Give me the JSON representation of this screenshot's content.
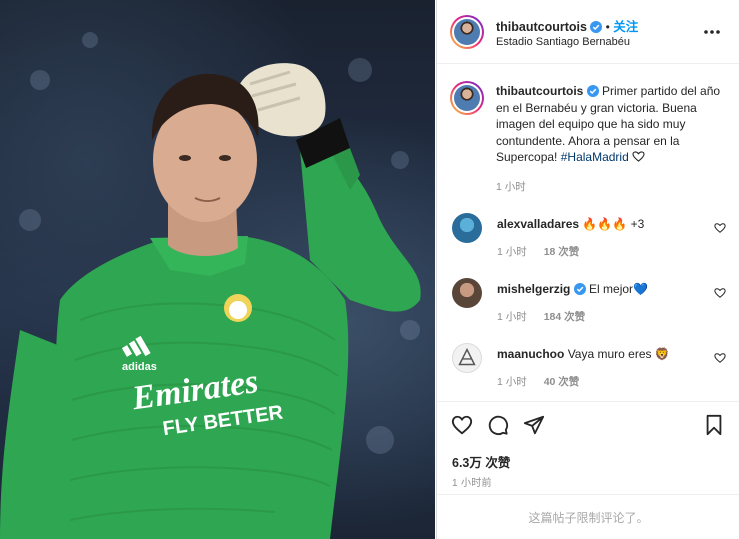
{
  "post": {
    "photo": {
      "jersey_sponsor_line1": "Emirates",
      "jersey_sponsor_line2": "FLY BETTER"
    }
  },
  "header": {
    "username": "thibautcourtois",
    "separator": "•",
    "follow_label": "关注",
    "location": "Estadio Santiago Bernabéu"
  },
  "caption": {
    "username": "thibautcourtois",
    "text": "Primer partido del año en el Bernabéu y gran victoria. Buena imagen del equipo que ha sido muy contundente. Ahora a pensar en la Supercopa!",
    "hashtag": "#HalaMadrid",
    "time": "1 小时"
  },
  "comments": [
    {
      "username": "alexvalladares",
      "text": "🔥🔥🔥 +3",
      "time": "1 小时",
      "likes": "18 次赞"
    },
    {
      "username": "mishelgerzig",
      "text": "El mejor💙",
      "time": "1 小时",
      "likes": "184 次赞"
    },
    {
      "username": "maanuchoo",
      "text": "Vaya muro eres 🦁",
      "time": "1 小时",
      "likes": "40 次赞"
    }
  ],
  "actions": {
    "likes_count": "6.3万 次赞",
    "post_time": "1 小时前",
    "comments_limited": "这篇帖子限制评论了。"
  },
  "colors": {
    "link_blue": "#0095f6",
    "verified_blue": "#3897f0",
    "text_primary": "#262626",
    "text_secondary": "#8e8e8e",
    "jersey_green": "#2fa651"
  },
  "icons": [
    "verified-icon",
    "more-options-icon",
    "heart-icon",
    "comment-icon",
    "share-icon",
    "bookmark-icon"
  ]
}
